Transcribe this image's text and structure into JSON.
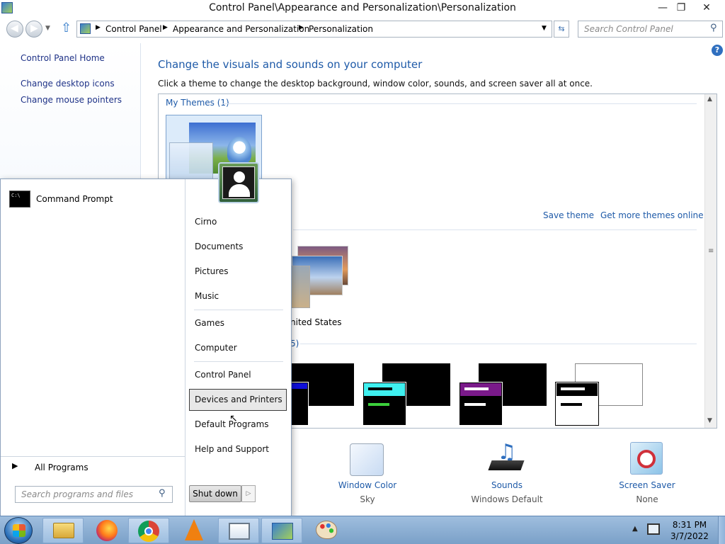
{
  "window": {
    "title": "Control Panel\\Appearance and Personalization\\Personalization",
    "minimize": "—",
    "restore": "❐",
    "close": "✕"
  },
  "address": {
    "crumbs": [
      "Control Panel",
      "Appearance and Personalization",
      "Personalization"
    ],
    "search_placeholder": "Search Control Panel"
  },
  "left_pane": {
    "home": "Control Panel Home",
    "links": [
      "Change desktop icons",
      "Change mouse pointers"
    ]
  },
  "main": {
    "heading": "Change the visuals and sounds on your computer",
    "subtext": "Click a theme to change the desktop background, window color, sounds, and screen saver all at once.",
    "my_themes": "My Themes (1)",
    "save_theme": "Save theme",
    "get_more": "Get more themes online",
    "partial_theme_label": "nited States",
    "partial_group_label": "5)"
  },
  "bottom_settings": [
    {
      "label": "Window Color",
      "value": "Sky",
      "icon": "window-color-icon"
    },
    {
      "label": "Sounds",
      "value": "Windows Default",
      "icon": "sounds-icon"
    },
    {
      "label": "Screen Saver",
      "value": "None",
      "icon": "screen-saver-icon"
    }
  ],
  "start_menu": {
    "pinned": [
      "Command Prompt"
    ],
    "all_programs": "All Programs",
    "search_placeholder": "Search programs and files",
    "right_items": [
      "Cirno",
      "Documents",
      "Pictures",
      "Music",
      "Games",
      "Computer",
      "Control Panel",
      "Devices and Printers",
      "Default Programs",
      "Help and Support"
    ],
    "highlighted": "Devices and Printers",
    "shutdown": "Shut down"
  },
  "clock": {
    "time": "8:31 PM",
    "date": "3/7/2022"
  },
  "colors": {
    "link_blue": "#1e5aa8",
    "heading_blue": "#1e5aa8",
    "taskbar": "#8fb2d9"
  }
}
